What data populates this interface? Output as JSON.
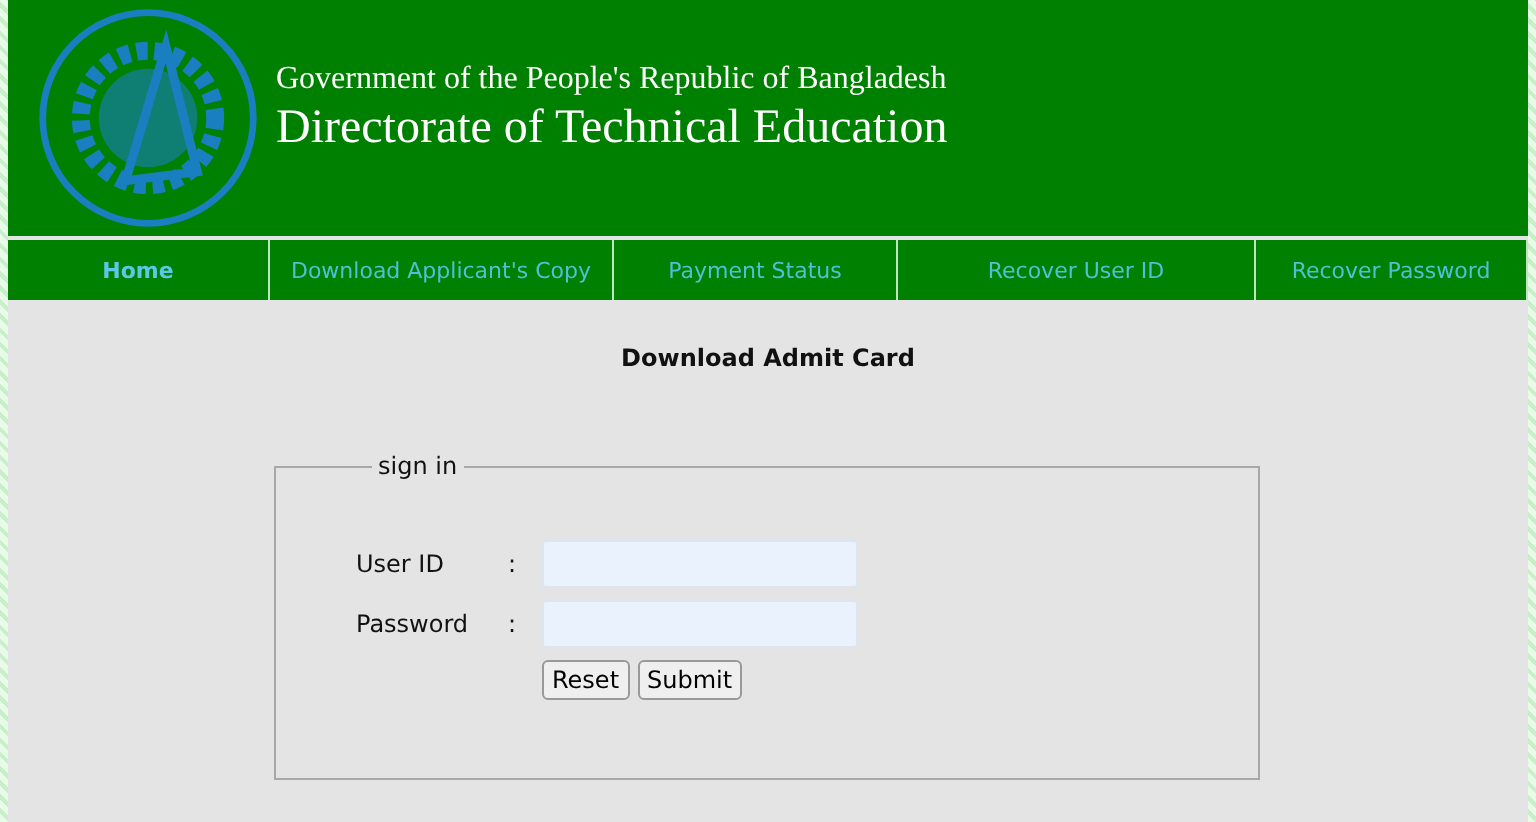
{
  "header": {
    "subtitle": "Government of the People's Republic of Bangladesh",
    "title": "Directorate of Technical Education"
  },
  "nav": [
    {
      "label": "Home",
      "selected": true
    },
    {
      "label": "Download Applicant's Copy",
      "selected": false
    },
    {
      "label": "Payment Status",
      "selected": false
    },
    {
      "label": "Recover User ID",
      "selected": false
    },
    {
      "label": "Recover Password",
      "selected": false
    }
  ],
  "page_title": "Download Admit Card",
  "form": {
    "legend": "sign in",
    "fields": [
      {
        "label": "User ID",
        "separator": ":"
      },
      {
        "label": "Password",
        "separator": ":"
      }
    ],
    "buttons": [
      "Reset",
      "Submit"
    ]
  }
}
